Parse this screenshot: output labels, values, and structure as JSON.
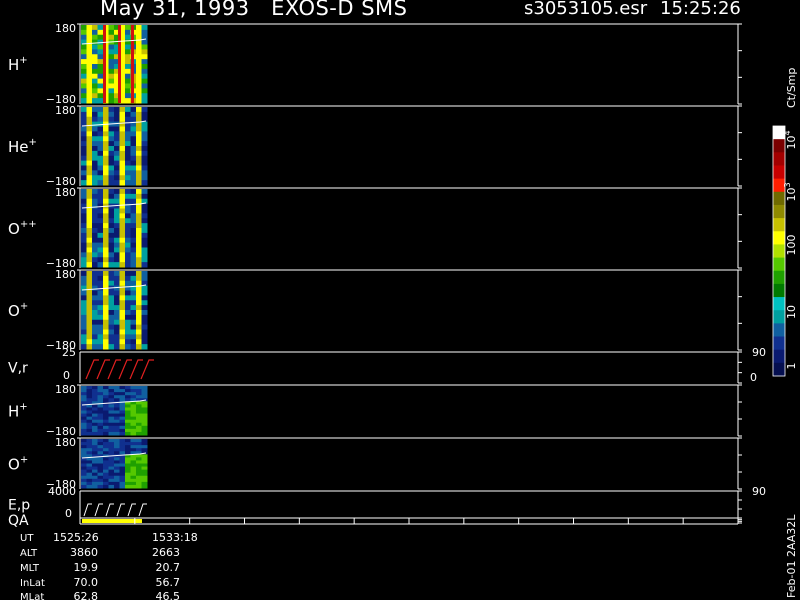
{
  "header": {
    "title": "May 31, 1993   EXOS-D SMS",
    "file": "s3053105.esr",
    "time": "15:25:26"
  },
  "panels": [
    {
      "label": "H",
      "sup": "+",
      "ymax": "180",
      "ymin": "−180",
      "kind": "spec"
    },
    {
      "label": "He",
      "sup": "+",
      "ymax": "180",
      "ymin": "−180",
      "kind": "spec"
    },
    {
      "label": "O",
      "sup": "++",
      "ymax": "180",
      "ymin": "−180",
      "kind": "spec"
    },
    {
      "label": "O",
      "sup": "+",
      "ymax": "180",
      "ymin": "−180",
      "kind": "spec"
    },
    {
      "label": "V,r",
      "sup": "",
      "ymax": "25",
      "ymin": "0",
      "kind": "line",
      "right_top": "90",
      "right_bottom": "0"
    },
    {
      "label": "H",
      "sup": "+",
      "ymax": "180",
      "ymin": "−180",
      "kind": "spec"
    },
    {
      "label": "O",
      "sup": "+",
      "ymax": "180",
      "ymin": "−180",
      "kind": "spec"
    },
    {
      "label": "E,p",
      "sup": "",
      "ymax": "4000",
      "ymin": "",
      "kind": "line",
      "right_top": "90",
      "right_bottom": ""
    },
    {
      "label": "QA",
      "sup": "",
      "ymax": "",
      "ymin": "0",
      "kind": "qa",
      "right_top": "",
      "right_bottom": "0"
    }
  ],
  "colorbar": {
    "unit": "Ct/Smp",
    "ticks": [
      "10",
      "10",
      "100",
      "10",
      "1"
    ],
    "tick_sups": [
      "4",
      "3",
      "",
      "",
      ""
    ],
    "colors": [
      "#ffffff",
      "#7a0000",
      "#a30000",
      "#c80000",
      "#ff1e00",
      "#6f6a00",
      "#8f8a00",
      "#c7c000",
      "#ffff00",
      "#b0e000",
      "#55c800",
      "#1fa000",
      "#007a00",
      "#00c0c0",
      "#00a0a0",
      "#1060a0",
      "#10308f",
      "#0a1a70",
      "#050f50"
    ]
  },
  "footer": {
    "rows": [
      {
        "name": "UT",
        "v1": "1525:26",
        "v2": "1533:18"
      },
      {
        "name": "ALT",
        "v1": "3860",
        "v2": "2663"
      },
      {
        "name": "MLT",
        "v1": "19.9",
        "v2": "20.7"
      },
      {
        "name": "InLat",
        "v1": "70.0",
        "v2": "56.7"
      },
      {
        "name": "MLat",
        "v1": "62.8",
        "v2": "46.5"
      }
    ],
    "stamp": "Feb-01 2AA32L"
  },
  "chart_data": {
    "type": "heatmap",
    "title": "May 31, 1993   EXOS-D SMS",
    "x_range": [
      "1525:26",
      "1533:18"
    ],
    "panels": [
      "H+",
      "He+",
      "O++",
      "O+",
      "V,r",
      "H+",
      "O+",
      "E,p",
      "QA"
    ],
    "y_range_pitch": [
      -180,
      180
    ],
    "colorbar_unit": "Ct/Smp",
    "colorbar_range": [
      1,
      10000
    ]
  }
}
